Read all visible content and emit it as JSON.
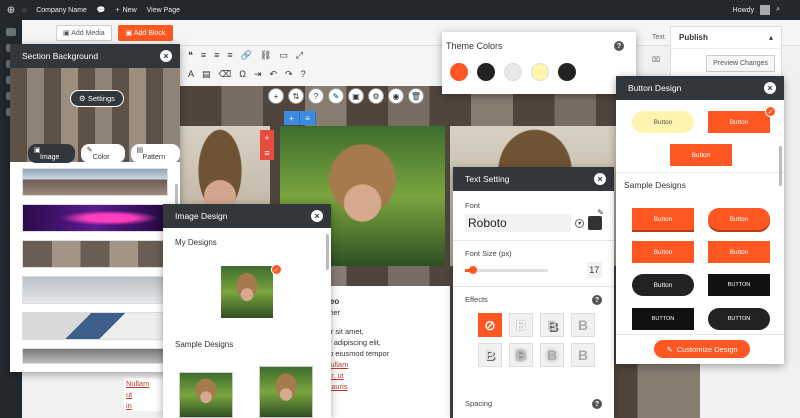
{
  "adminbar": {
    "site_name": "Company Name",
    "new_label": "New",
    "view_page_label": "View Page",
    "howdy_label": "Howdy"
  },
  "editorbar": {
    "add_media_label": "Add Media",
    "add_block_label": "Add Block"
  },
  "publish": {
    "title": "Publish",
    "preview_label": "Preview Changes"
  },
  "side_labels": {
    "text": "Text"
  },
  "section_background": {
    "title": "Section Background",
    "settings_label": "Settings",
    "tabs": [
      "Image",
      "Color",
      "Pattern"
    ]
  },
  "image_design": {
    "title": "Image Design",
    "my_designs_label": "My Designs",
    "sample_designs_label": "Sample Designs"
  },
  "theme_colors": {
    "title": "Theme Colors",
    "colors": [
      "#ff5722",
      "#222222",
      "#e8e8e8",
      "#fff3b0",
      "#222222"
    ]
  },
  "text_setting": {
    "title": "Text Setting",
    "font_label": "Font",
    "font_value": "Roboto",
    "font_size_label": "Font Size (px)",
    "font_size_value": "17",
    "font_size_level": 0.1,
    "effects_label": "Effects",
    "effect_glyph": "B",
    "spacing_label": "Spacing"
  },
  "button_design": {
    "title": "Button Design",
    "button_label": "Button",
    "button_label_upper": "BUTTON",
    "sample_designs_label": "Sample Designs",
    "customize_label": "Customize Design",
    "accent": "#ff5722"
  },
  "article": {
    "name_fragment": "neo",
    "role_fragment": "pher",
    "lines": [
      "lor sit amet,",
      "ur adipiscing elit,",
      "do eiusmod tempor",
      "Nullam",
      "tor, ut",
      "mauris"
    ],
    "left_lines": [
      "Nullam",
      "ut",
      "in"
    ]
  }
}
